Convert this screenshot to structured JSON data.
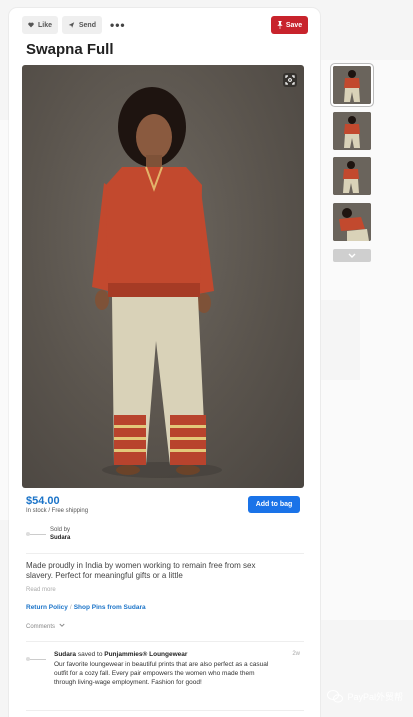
{
  "toolbar": {
    "like_label": "Like",
    "send_label": "Send",
    "more_label": "•••",
    "save_label": "Save"
  },
  "pin": {
    "title": "Swapna Full",
    "price": "$54.00",
    "stock": "In stock / Free shipping",
    "add_to_bag_label": "Add to bag",
    "sold_by_label": "Sold by",
    "seller_name": "Sudara",
    "description": "Made proudly in India by women working to remain free from sex slavery. Perfect for meaningful gifts or a little",
    "read_more_label": "Read more",
    "return_policy_label": "Return Policy",
    "link_separator": "/",
    "shop_pins_label": "Shop Pins from Sudara",
    "comments_label": "Comments"
  },
  "activity": {
    "user": "Sudara",
    "action": "saved to",
    "board": "Punjammies® Loungewear",
    "time": "2w",
    "body": "Our favorite loungewear in beautiful prints that are also perfect as a casual outfit for a cozy fall. Every pair empowers the women who made them through living-wage employment. Fashion for good!"
  },
  "watermark": {
    "text": "PayPal外贸帮"
  },
  "colors": {
    "save_red": "#c8232c",
    "link_blue": "#1a73c8",
    "top_red": "#c2492e",
    "pants_cream": "#d9d2b8"
  },
  "icons": [
    "heart-icon",
    "send-icon",
    "more-icon",
    "pin-icon",
    "expand-icon",
    "chevron-down-icon",
    "wechat-icon"
  ]
}
